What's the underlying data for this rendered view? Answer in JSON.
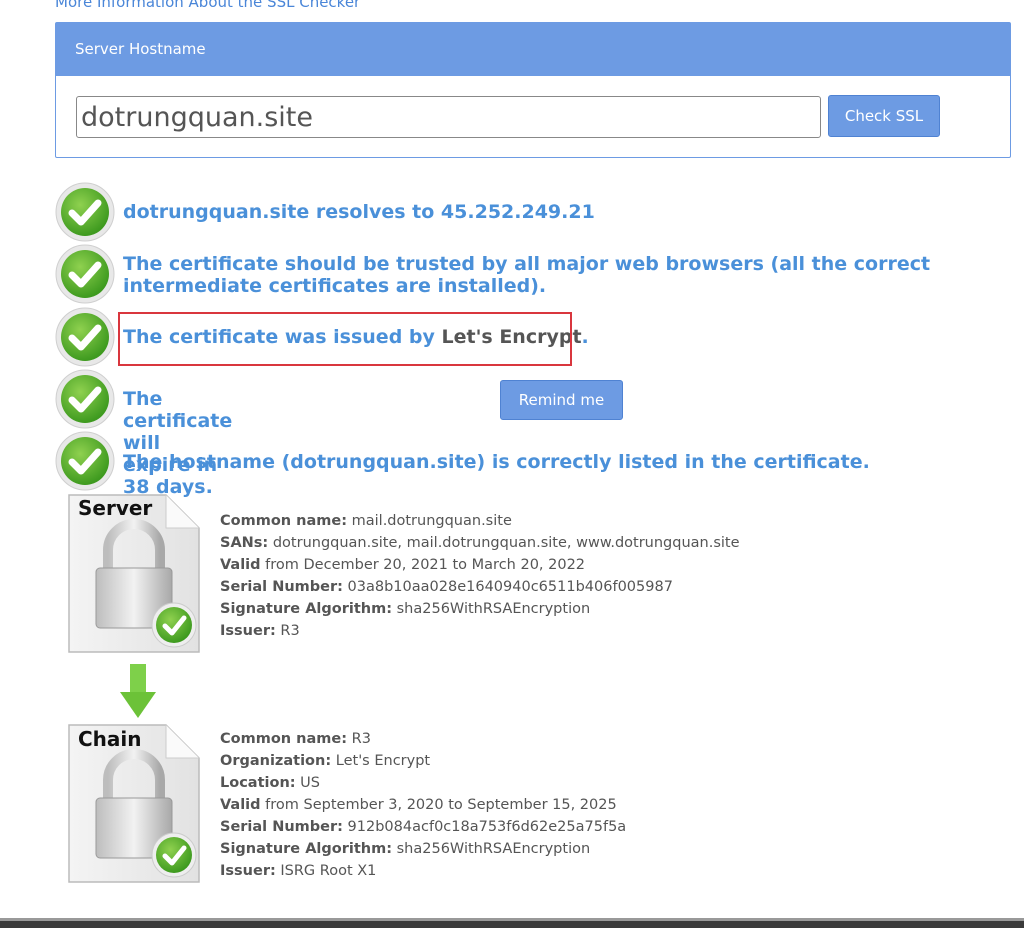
{
  "top_link": "More Information About the SSL Checker",
  "panel": {
    "title": "Server Hostname",
    "hostname_value": "dotrungquan.site",
    "check_button": "Check SSL"
  },
  "results": [
    {
      "text": "dotrungquan.site resolves to 45.252.249.21",
      "icon": "green-check-icon"
    },
    {
      "text": "The certificate should be trusted by all major web browsers (all the correct intermediate certificates are installed).",
      "icon": "green-check-icon"
    },
    {
      "text": "The certificate was issued by ",
      "issuer": "Let's Encrypt",
      "suffix": ".",
      "icon": "green-check-icon"
    },
    {
      "text": "The certificate will expire in 38 days.",
      "button": "Remind me",
      "icon": "green-check-icon"
    },
    {
      "text": "The hostname (dotrungquan.site) is correctly listed in the certificate.",
      "icon": "green-check-icon"
    }
  ],
  "server_cert": {
    "label": "Server",
    "fields": [
      {
        "k": "Common name:",
        "v": " mail.dotrungquan.site"
      },
      {
        "k": "SANs:",
        "v": " dotrungquan.site, mail.dotrungquan.site, www.dotrungquan.site"
      },
      {
        "k": "Valid",
        "v": " from December 20, 2021 to March 20, 2022"
      },
      {
        "k": "Serial Number:",
        "v": " 03a8b10aa028e1640940c6511b406f005987"
      },
      {
        "k": "Signature Algorithm:",
        "v": " sha256WithRSAEncryption"
      },
      {
        "k": "Issuer:",
        "v": " R3"
      }
    ]
  },
  "chain_cert": {
    "label": "Chain",
    "fields": [
      {
        "k": "Common name:",
        "v": " R3"
      },
      {
        "k": "Organization:",
        "v": " Let's Encrypt"
      },
      {
        "k": "Location:",
        "v": " US"
      },
      {
        "k": "Valid",
        "v": " from September 3, 2020 to September 15, 2025"
      },
      {
        "k": "Serial Number:",
        "v": " 912b084acf0c18a753f6d62e25a75f5a"
      },
      {
        "k": "Signature Algorithm:",
        "v": " sha256WithRSAEncryption"
      },
      {
        "k": "Issuer:",
        "v": " ISRG Root X1"
      }
    ]
  },
  "colors": {
    "accent": "#6d9be3",
    "result_text": "#4a90d9",
    "highlight_box": "#d9363e",
    "check_green": "#5cb531"
  }
}
